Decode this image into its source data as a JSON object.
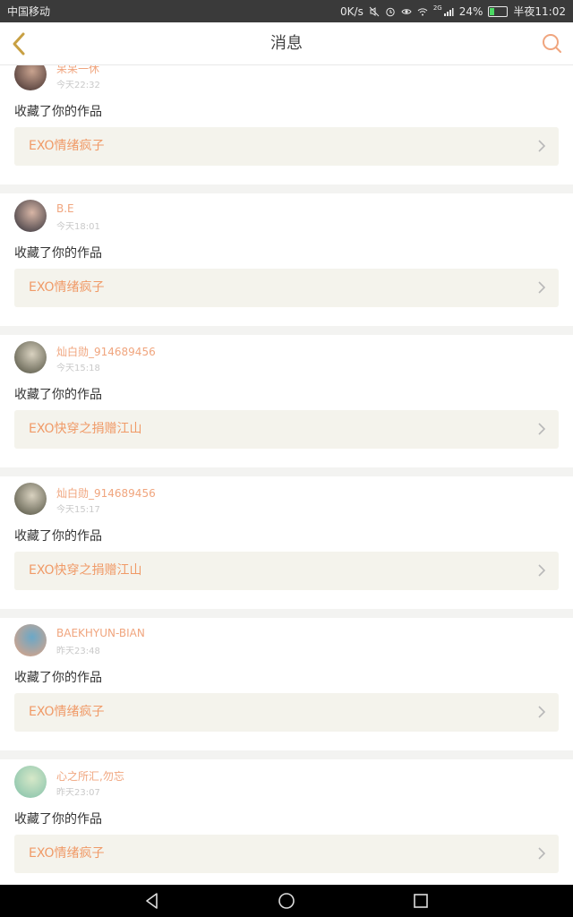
{
  "status_bar": {
    "carrier": "中国移动",
    "speed": "0K/s",
    "battery": "24%",
    "battery_level": 0.24,
    "time": "半夜11:02",
    "net": "2G"
  },
  "header": {
    "title": "消息"
  },
  "colors": {
    "accent": "#f09a67",
    "username": "#f0a57e",
    "link_bg": "#f4f3ec",
    "icon_gold": "#c8a043"
  },
  "messages": [
    {
      "user": "呆呆一休",
      "time": "今天22:32",
      "action": "收藏了你的作品",
      "work": "EXO情绪疯子"
    },
    {
      "user": "B.E",
      "time": "今天18:01",
      "action": "收藏了你的作品",
      "work": "EXO情绪疯子"
    },
    {
      "user": "灿白勋_914689456",
      "time": "今天15:18",
      "action": "收藏了你的作品",
      "work": "EXO快穿之捐赠江山"
    },
    {
      "user": "灿白勋_914689456",
      "time": "今天15:17",
      "action": "收藏了你的作品",
      "work": "EXO快穿之捐赠江山"
    },
    {
      "user": "BAEKHYUN-BIAN",
      "time": "昨天23:48",
      "action": "收藏了你的作品",
      "work": "EXO情绪疯子"
    },
    {
      "user": "心之所汇,勿忘",
      "time": "昨天23:07",
      "action": "收藏了你的作品",
      "work": "EXO情绪疯子"
    }
  ]
}
